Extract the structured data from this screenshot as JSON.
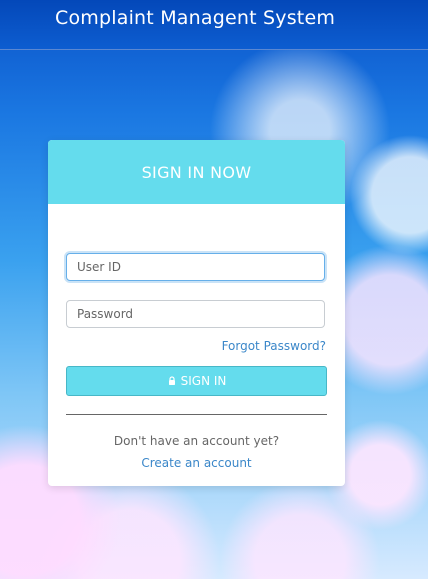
{
  "app": {
    "title": "Complaint Managent System"
  },
  "login": {
    "header": "SIGN IN NOW",
    "user_id_placeholder": "User ID",
    "password_placeholder": "Password",
    "forgot_password_label": "Forgot Password?",
    "signin_label": "SIGN IN",
    "signin_icon": "lock-icon",
    "no_account_text": "Don't have an account yet?",
    "create_account_label": "Create an account"
  },
  "colors": {
    "header_bg": "#0448b9",
    "accent": "#64dced",
    "link": "#3b87c9"
  }
}
